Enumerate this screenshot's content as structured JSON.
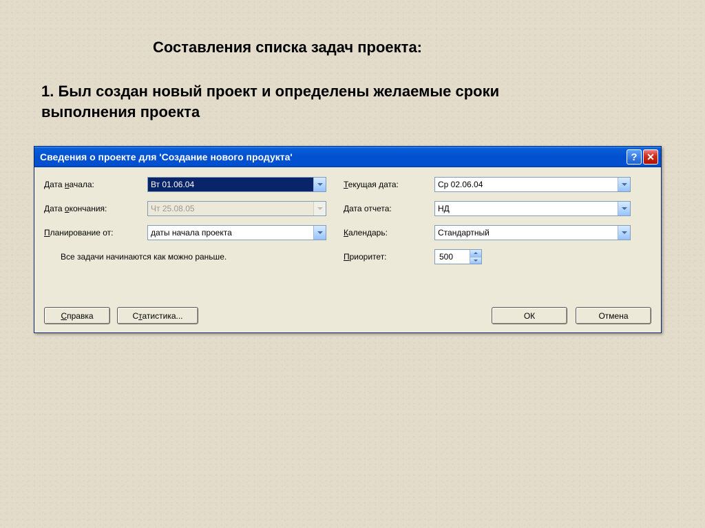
{
  "page": {
    "title": "Составления списка задач проекта:",
    "subtitle": "1. Был создан новый проект и определены желаемые сроки\nвыполнения проекта"
  },
  "dialog": {
    "title": "Сведения о проекте для 'Создание нового продукта'",
    "labels": {
      "start_date": "Дата начала:",
      "end_date": "Дата окончания:",
      "schedule_from": "Планирование от:",
      "current_date": "Текущая дата:",
      "report_date": "Дата отчета:",
      "calendar": "Календарь:",
      "priority": "Приоритет:"
    },
    "hotkeys": {
      "start_date": "н",
      "end_date": "о",
      "schedule_from": "П",
      "current_date": "Т",
      "report_date": "Д",
      "calendar": "К",
      "priority": "П",
      "help": "С",
      "stats": "т"
    },
    "values": {
      "start_date": "Вт 01.06.04",
      "end_date": "Чт 25.08.05",
      "schedule_from": "даты начала проекта",
      "current_date": "Ср 02.06.04",
      "report_date": "НД",
      "calendar": "Стандартный",
      "priority": "500"
    },
    "hint": "Все задачи начинаются как можно раньше.",
    "buttons": {
      "help": "Справка",
      "stats": "Статистика...",
      "ok": "ОК",
      "cancel": "Отмена"
    }
  }
}
